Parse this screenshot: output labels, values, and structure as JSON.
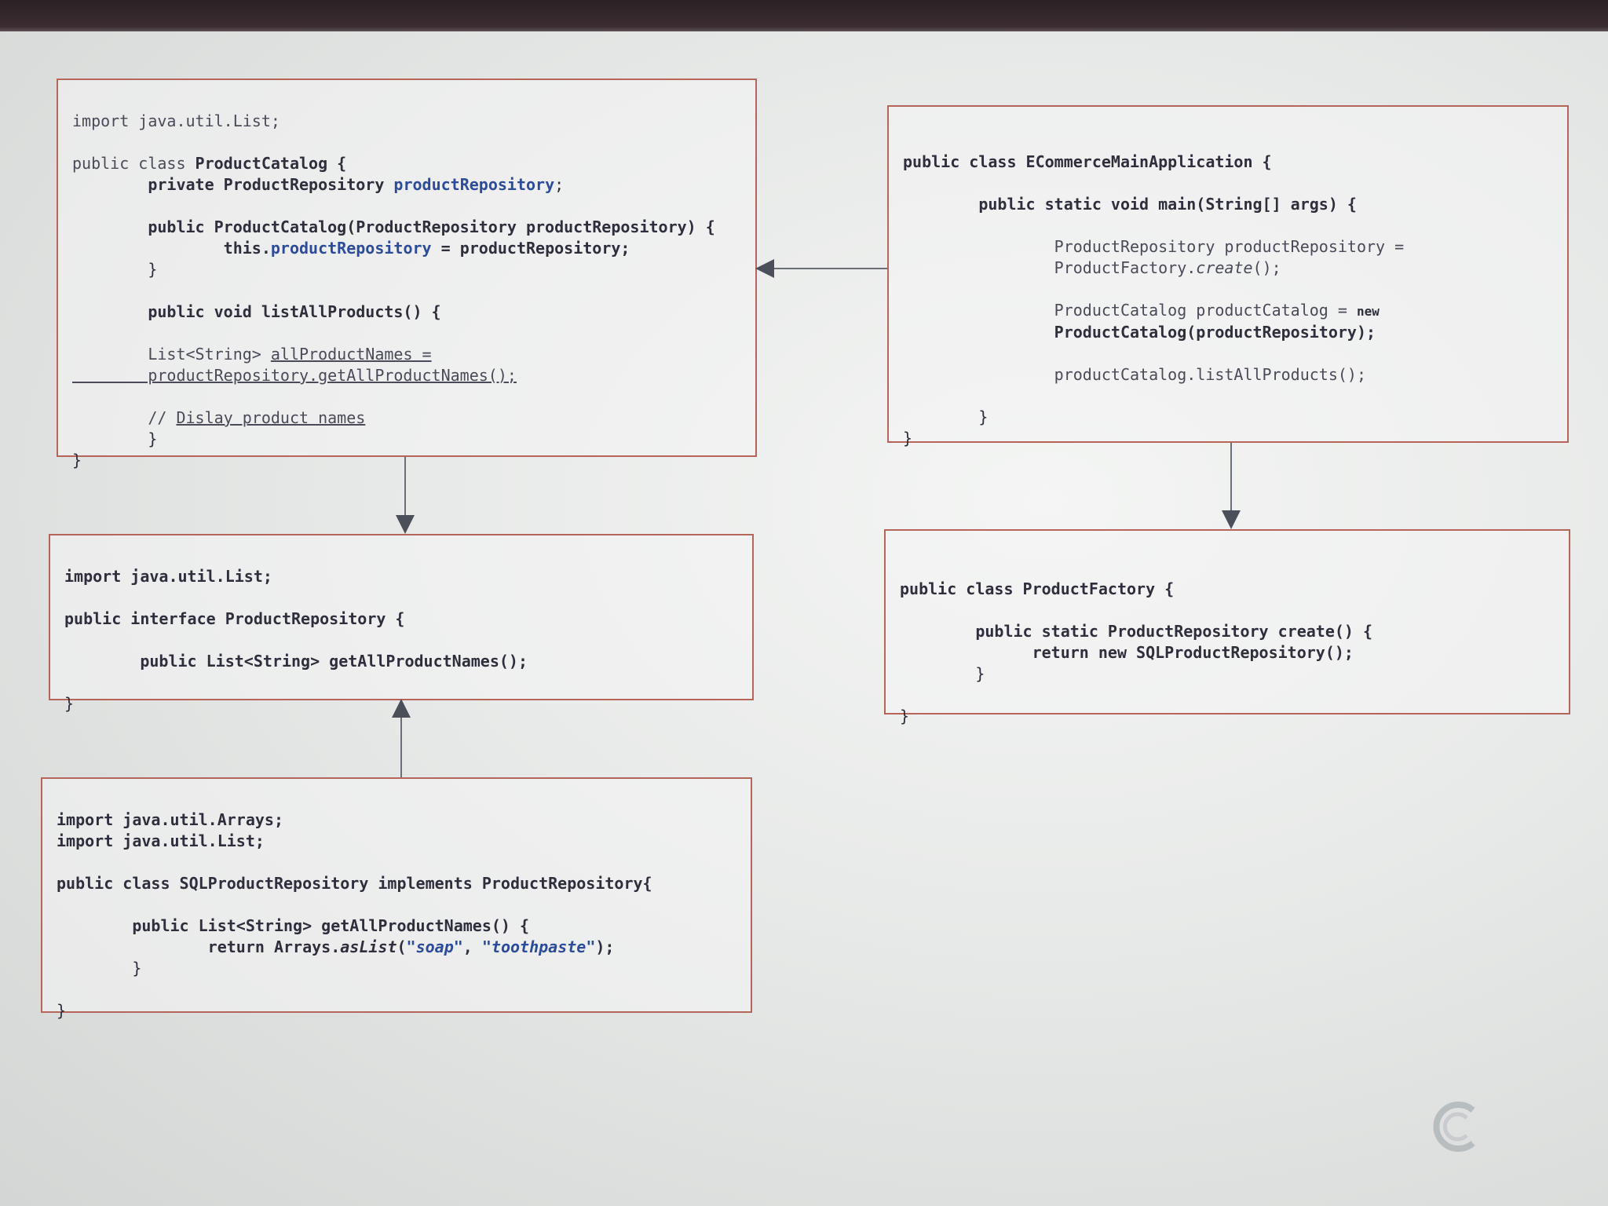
{
  "boxes": {
    "catalog": {
      "l1": "import java.util.List;",
      "l2a": "public class ",
      "l2b": "ProductCatalog {",
      "l3a": "        private ProductRepository ",
      "l3b": "productRepository",
      "l3c": ";",
      "l4": "        public ProductCatalog(ProductRepository productRepository) {",
      "l5a": "                this.",
      "l5b": "productRepository",
      "l5c": " = productRepository;",
      "l6": "        }",
      "l7": "        public void listAllProducts() {",
      "l8a": "        List<String> ",
      "l8b": "allProductNames =",
      "l9": "        productRepository.getAllProductNames();",
      "l10a": "        // ",
      "l10b": "Dislay product names",
      "l11": "        }",
      "l12": "}"
    },
    "main": {
      "l1": "public class ECommerceMainApplication {",
      "l2": "        public static void main(String[] args) {",
      "l3": "                ProductRepository productRepository =",
      "l4a": "                ProductFactory.",
      "l4b": "create",
      "l4c": "();",
      "l5a": "                ProductCatalog productCatalog = ",
      "l5b": "new",
      "l6": "                ProductCatalog(productRepository);",
      "l7": "                productCatalog.listAllProducts();",
      "l8": "        }",
      "l9": "}"
    },
    "repo": {
      "l1": "import java.util.List;",
      "l2": "public interface ProductRepository {",
      "l3": "        public List<String> getAllProductNames();",
      "l4": "}"
    },
    "factory": {
      "l1": "public class ProductFactory {",
      "l2": "        public static ProductRepository create() {",
      "l3": "              return new SQLProductRepository();",
      "l4": "        }",
      "l5": "}"
    },
    "sql": {
      "l1": "import java.util.Arrays;",
      "l2": "import java.util.List;",
      "l3": "public class SQLProductRepository implements ProductRepository{",
      "l4": "        public List<String> getAllProductNames() {",
      "l5a": "                return Arrays.",
      "l5b": "asList",
      "l5c": "(",
      "l5d": "\"soap\"",
      "l5e": ", ",
      "l5f": "\"toothpaste\"",
      "l5g": ");",
      "l6": "        }",
      "l7": "}"
    }
  },
  "colors": {
    "border": "#b5655a",
    "accent": "#2c4c9a",
    "text": "#2e2e3c"
  }
}
